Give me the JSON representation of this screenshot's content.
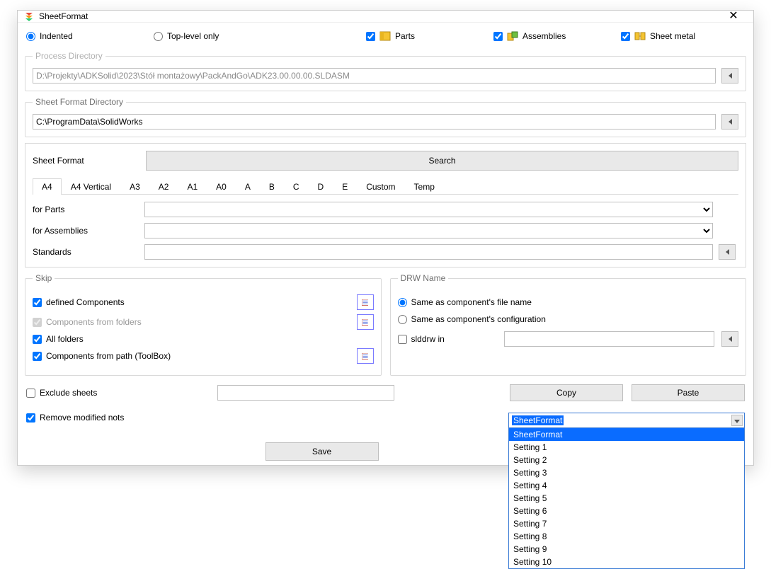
{
  "window": {
    "title": "SheetFormat"
  },
  "top": {
    "indented": "Indented",
    "topLevelOnly": "Top-level only",
    "parts": "Parts",
    "assemblies": "Assemblies",
    "sheetMetal": "Sheet metal",
    "indentedSelected": true,
    "partsChecked": true,
    "assembliesChecked": true,
    "sheetMetalChecked": true
  },
  "processDir": {
    "legend": "Process Directory",
    "value": "D:\\Projekty\\ADKSolid\\2023\\Stół montażowy\\PackAndGo\\ADK23.00.00.00.SLDASM"
  },
  "sheetDir": {
    "legend": "Sheet Format Directory",
    "value": "C:\\ProgramData\\SolidWorks"
  },
  "sheetFormat": {
    "label": "Sheet Format",
    "searchLabel": "Search",
    "tabs": [
      "A4",
      "A4 Vertical",
      "A3",
      "A2",
      "A1",
      "A0",
      "A",
      "B",
      "C",
      "D",
      "E",
      "Custom",
      "Temp"
    ],
    "activeTab": 0,
    "forParts": "for Parts",
    "forAssemblies": "for Assemblies",
    "standards": "Standards"
  },
  "skip": {
    "legend": "Skip",
    "definedComponents": "defined Components",
    "componentsFromFolders": "Components from folders",
    "allFolders": "All folders",
    "componentsFromPath": "Components from path (ToolBox)",
    "definedChecked": true,
    "foldersChecked": true,
    "allFoldersChecked": true,
    "pathChecked": true
  },
  "drw": {
    "legend": "DRW Name",
    "sameFile": "Same as component's file name",
    "sameConfig": "Same as component's configuration",
    "slddrwIn": "slddrw in",
    "selected": "file"
  },
  "bottom": {
    "excludeSheets": "Exclude sheets",
    "removeModified": "Remove modified nots",
    "excludeChecked": false,
    "removeChecked": true,
    "copy": "Copy",
    "paste": "Paste",
    "save": "Save"
  },
  "settingsCombo": {
    "selected": "SheetFormat",
    "options": [
      "SheetFormat",
      "Setting 1",
      "Setting 2",
      "Setting 3",
      "Setting 4",
      "Setting 5",
      "Setting 6",
      "Setting 7",
      "Setting 8",
      "Setting 9",
      "Setting 10"
    ]
  }
}
